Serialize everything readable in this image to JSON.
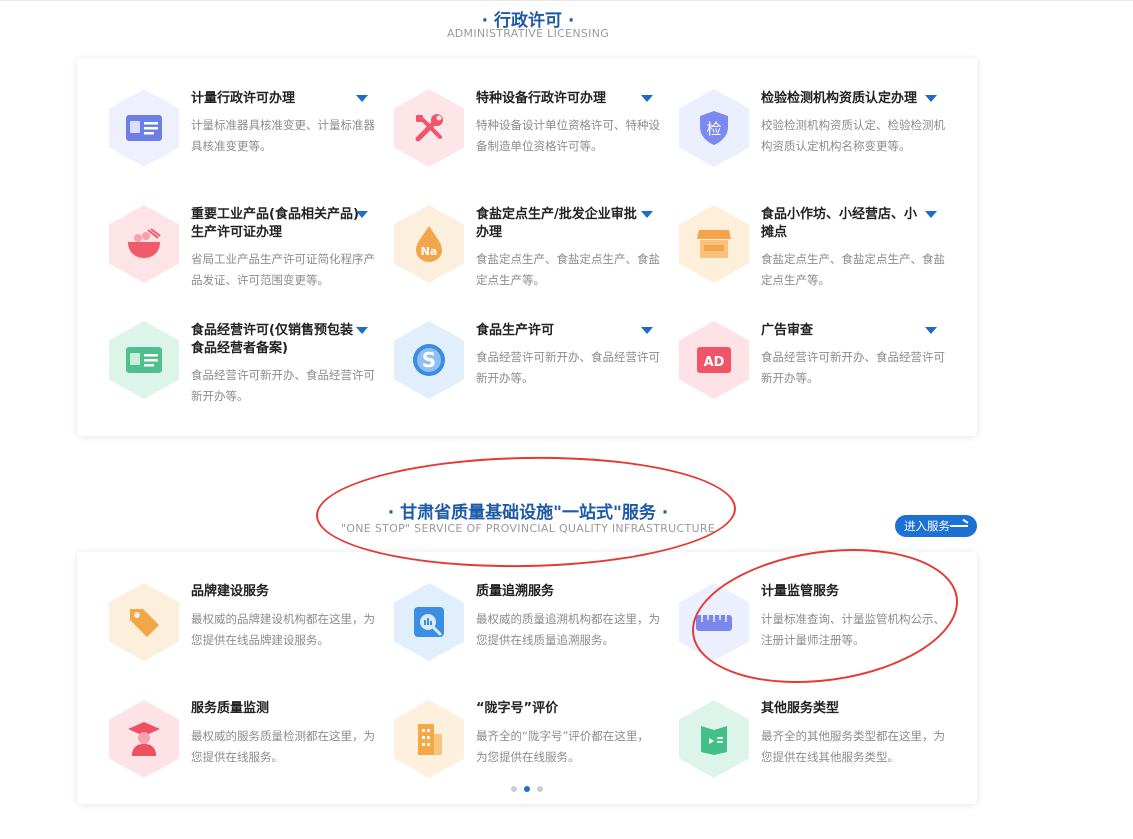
{
  "section1": {
    "title": "· 行政许可 ·",
    "subtitle": "ADMINISTRATIVE LICENSING",
    "items": [
      {
        "title": "计量行政许可办理",
        "desc": "计量标准器具核准变更、计量标准器具核准变更等。",
        "icon": "id-card-icon",
        "color": "#6c7fe6"
      },
      {
        "title": "特种设备行政许可办理",
        "desc": "特种设备设计单位资格许可、特种设备制造单位资格许可等。",
        "icon": "tools-icon",
        "color": "#f0566b"
      },
      {
        "title": "检验检测机构资质认定办理",
        "desc": "校验检测机构资质认定、检验检测机构资质认定机构名称变更等。",
        "icon": "inspection-shield-icon",
        "color": "#7b8af0",
        "glyph": "检"
      },
      {
        "title": "重要工业产品(食品相关产品)生产许可证办理",
        "desc": "省局工业产品生产许可证简化程序产品发证、许可范围变更等。",
        "icon": "food-bowl-icon",
        "color": "#f05a6a"
      },
      {
        "title": "食盐定点生产/批发企业审批办理",
        "desc": "食盐定点生产、食盐定点生产、食盐定点生产等。",
        "icon": "salt-drop-icon",
        "color": "#f2a64c",
        "glyph": "Na"
      },
      {
        "title": "食品小作坊、小经营店、小摊点",
        "desc": "食盐定点生产、食盐定点生产、食盐定点生产等。",
        "icon": "shop-stall-icon",
        "color": "#f4a44a"
      },
      {
        "title": "食品经营许可(仅销售预包装食品经营者备案)",
        "desc": "食品经营许可新开办、食品经营许可新开办等。",
        "icon": "license-card-icon",
        "color": "#4fc08d"
      },
      {
        "title": "食品生产许可",
        "desc": "食品经营许可新开办、食品经营许可新开办等。",
        "icon": "s-circle-icon",
        "color": "#3c8ce0",
        "glyph": "S"
      },
      {
        "title": "广告审查",
        "desc": "食品经营许可新开办、食品经营许可新开办等。",
        "icon": "ad-icon",
        "color": "#ef5468",
        "glyph": "AD"
      }
    ]
  },
  "section2": {
    "title": "· 甘肃省质量基础设施\"一站式\"服务 ·",
    "subtitle": "\"ONE STOP\" SERVICE OF PROVINCIAL QUALITY INFRASTRUCTURE",
    "enter_label": "进入服务",
    "items": [
      {
        "title": "品牌建设服务",
        "desc": "最权威的品牌建设机构都在这里，为您提供在线品牌建设服务。",
        "icon": "price-tag-icon",
        "color": "#f3a646"
      },
      {
        "title": "质量追溯服务",
        "desc": "最权威的质量追溯机构都在这里，为您提供在线质量追溯服务。",
        "icon": "trace-search-icon",
        "color": "#3b8fe3"
      },
      {
        "title": "计量监管服务",
        "desc": "计量标准查询、计量监管机构公示、注册计量师注册等。",
        "icon": "ruler-icon",
        "color": "#7b86ee"
      },
      {
        "title": "服务质量监测",
        "desc": "最权威的服务质量检测都在这里，为您提供在线服务。",
        "icon": "graduate-icon",
        "color": "#ef4f62"
      },
      {
        "title": "“陇字号”评价",
        "desc": "最齐全的“陇字号”评价都在这里，为您提供在线服务。",
        "icon": "building-icon",
        "color": "#f4a846"
      },
      {
        "title": "其他服务类型",
        "desc": "最齐全的其他服务类型都在这里，为您提供在线其他服务类型。",
        "icon": "book-icon",
        "color": "#43bf8a"
      }
    ]
  },
  "carousel": {
    "count": 3,
    "active": 1
  },
  "colors": {
    "accent": "#1e5aa8",
    "button": "#1d70d4",
    "annotation": "#e53935"
  }
}
